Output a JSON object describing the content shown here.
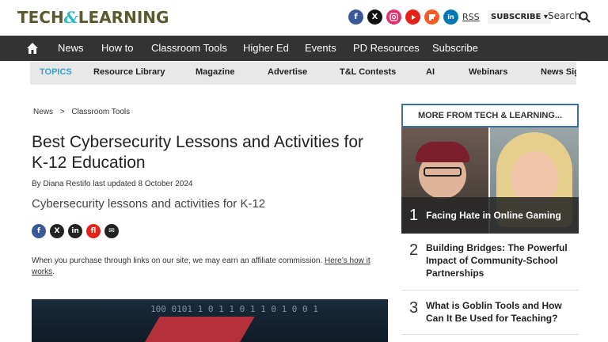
{
  "header": {
    "logo_part1": "TECH",
    "logo_amp": "&",
    "logo_part2": "LEARNING",
    "socials": [
      "f",
      "X",
      "ig",
      "yt",
      "fl",
      "in"
    ],
    "rss": "RSS",
    "subscribe": "SUBSCRIBE ▾",
    "search": "Search"
  },
  "nav": {
    "items": [
      "News",
      "How to",
      "Classroom Tools",
      "Higher Ed",
      "Events",
      "PD Resources",
      "Subscribe"
    ]
  },
  "topics": {
    "label": "TOPICS",
    "items": [
      "Resource Library",
      "Magazine",
      "Advertise",
      "T&L Contests",
      "AI",
      "Webinars",
      "News Sig"
    ]
  },
  "article": {
    "breadcrumb": [
      "News",
      ">",
      "Classroom Tools"
    ],
    "title": "Best Cybersecurity Lessons and Activities for K-12 Education",
    "byline": "By Diana Restifo last updated 8 October 2024",
    "subtitle": "Cybersecurity lessons and activities for K-12",
    "share": [
      "f",
      "X",
      "in",
      "fl",
      "✉"
    ],
    "affiliate_text": "When you purchase through links on our site, we may earn an affiliate commission.",
    "affiliate_link": "Here’s how it works",
    "affiliate_end": ".",
    "hero_bits": [
      "100   0101  1 0 1 1 0 1 1 0 1 0 0 1"
    ]
  },
  "sidebar": {
    "heading": "MORE FROM TECH & LEARNING...",
    "featured": {
      "number": "1",
      "title": "Facing Hate in Online Gaming"
    },
    "items": [
      {
        "number": "2",
        "title": "Building Bridges: The Powerful Impact of Community-School Partnerships"
      },
      {
        "number": "3",
        "title": "What is Goblin Tools and How Can It Be Used for Teaching?"
      }
    ]
  }
}
